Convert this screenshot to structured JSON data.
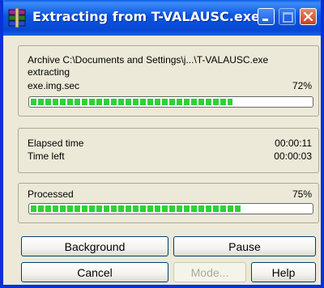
{
  "window": {
    "title": "Extracting from T-VALAUSC.exe"
  },
  "archive": {
    "path_line": "Archive C:\\Documents and Settings\\j...\\T-VALAUSC.exe",
    "action": "extracting",
    "current_file": "exe.img.sec",
    "file_progress_label": "72%",
    "file_progress": 0.72
  },
  "timing": {
    "elapsed_label": "Elapsed time",
    "elapsed_value": "00:00:11",
    "left_label": "Time left",
    "left_value": "00:00:03"
  },
  "processed": {
    "label": "Processed",
    "percent_label": "75%",
    "progress": 0.75
  },
  "buttons": {
    "background": "Background",
    "pause": "Pause",
    "cancel": "Cancel",
    "mode": "Mode...",
    "help": "Help"
  },
  "colors": {
    "titlebar": "#0a55e0",
    "progress_green": "#2dd235",
    "close_button": "#c8401f"
  },
  "icons": {
    "app": "winrar-books-icon",
    "minimize": "minimize-icon",
    "maximize": "maximize-icon",
    "close": "close-icon"
  }
}
